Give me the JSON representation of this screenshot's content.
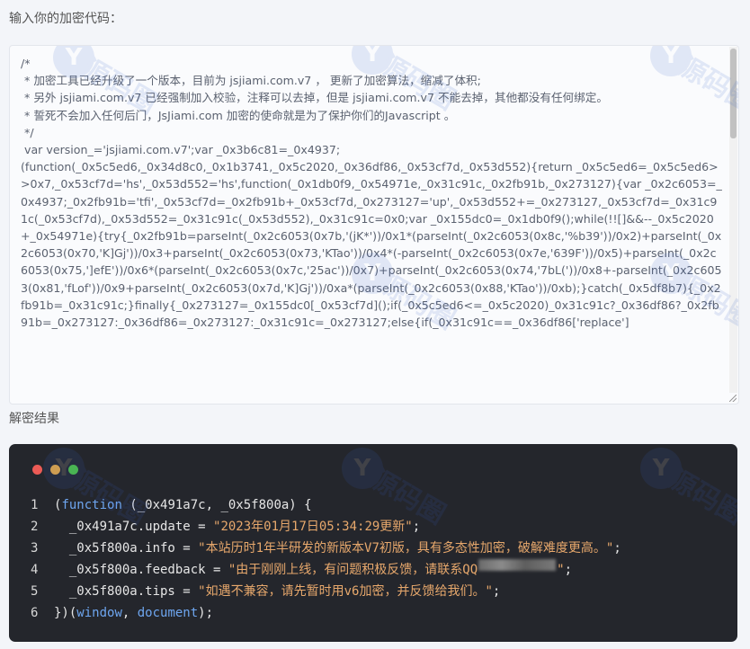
{
  "labels": {
    "input": "输入你的加密代码：",
    "result": "解密结果"
  },
  "input_code": "/*\n * 加密工具已经升级了一个版本，目前为 jsjiami.com.v7 ， 更新了加密算法，缩减了体积;\n * 另外 jsjiami.com.v7 已经强制加入校验，注释可以去掉，但是 jsjiami.com.v7 不能去掉，其他都没有任何绑定。\n * 誓死不会加入任何后门，JsJiami.com 加密的使命就是为了保护你们的Javascript 。\n */\n var version_='jsjiami.com.v7';var _0x3b6c81=_0x4937;\n(function(_0x5c5ed6,_0x34d8c0,_0x1b3741,_0x5c2020,_0x36df86,_0x53cf7d,_0x53d552){return _0x5c5ed6=_0x5c5ed6>>0x7,_0x53cf7d='hs',_0x53d552='hs',function(_0x1db0f9,_0x54971e,_0x31c91c,_0x2fb91b,_0x273127){var _0x2c6053=_0x4937;_0x2fb91b='tfi',_0x53cf7d=_0x2fb91b+_0x53cf7d,_0x273127='up',_0x53d552+=_0x273127,_0x53cf7d=_0x31c91c(_0x53cf7d),_0x53d552=_0x31c91c(_0x53d552),_0x31c91c=0x0;var _0x155dc0=_0x1db0f9();while(!![]&&--_0x5c2020+_0x54971e){try{_0x2fb91b=parseInt(_0x2c6053(0x7b,'(jK*'))/0x1*(parseInt(_0x2c6053(0x8c,'%b39'))/0x2)+parseInt(_0x2c6053(0x70,'K]Gj'))/0x3+parseInt(_0x2c6053(0x73,'KTao'))/0x4*(-parseInt(_0x2c6053(0x7e,'639F'))/0x5)+parseInt(_0x2c6053(0x75,']efE'))/0x6*(parseInt(_0x2c6053(0x7c,'25ac'))/0x7)+parseInt(_0x2c6053(0x74,'7bL('))/0x8+-parseInt(_0x2c6053(0x81,'fLof'))/0x9+parseInt(_0x2c6053(0x7d,'K]Gj'))/0xa*(parseInt(_0x2c6053(0x88,'KTao'))/0xb);}catch(_0x5df8b7){_0x2fb91b=_0x31c91c;}finally{_0x273127=_0x155dc0[_0x53cf7d]();if(_0x5c5ed6<=_0x5c2020)_0x31c91c?_0x36df86?_0x2fb91b=_0x273127:_0x36df86=_0x273127:_0x31c91c=_0x273127;else{if(_0x31c91c==_0x36df86['replace']",
  "result": {
    "line_numbers": [
      "1",
      "2",
      "3",
      "4",
      "5",
      "6"
    ],
    "line1": {
      "open": "(",
      "keyword": "function",
      "rest": " (_0x491a7c, _0x5f800a) {"
    },
    "line2": {
      "prefix": "  _0x491a7c.update = ",
      "value": "\"2023年01月17日05:34:29更新\"",
      "suffix": ";"
    },
    "line3": {
      "prefix": "  _0x5f800a.info = ",
      "value": "\"本站历时1年半研发的新版本V7初版，具有多态性加密，破解难度更高。\"",
      "suffix": ";"
    },
    "line4": {
      "prefix": "  _0x5f800a.feedback = ",
      "value_start": "\"由于刚刚上线，有问题积极反馈，请联系QQ",
      "value_end": "\"",
      "suffix": ";"
    },
    "line5": {
      "prefix": "  _0x5f800a.tips = ",
      "value": "\"如遇不兼容，请先暂时用v6加密，并反馈给我们。\"",
      "suffix": ";"
    },
    "line6": {
      "open": "})(",
      "arg1": "window",
      "sep": ", ",
      "arg2": "document",
      "close": ");"
    }
  },
  "watermark": {
    "logo": "Y",
    "text": "源码圈"
  },
  "colors": {
    "panel_bg": "#24262c",
    "keyword": "#6ea6f0",
    "string": "#e7a86c",
    "dot_red": "#ec5b56",
    "dot_yellow": "#e5a741",
    "dot_green": "#4cc142"
  }
}
